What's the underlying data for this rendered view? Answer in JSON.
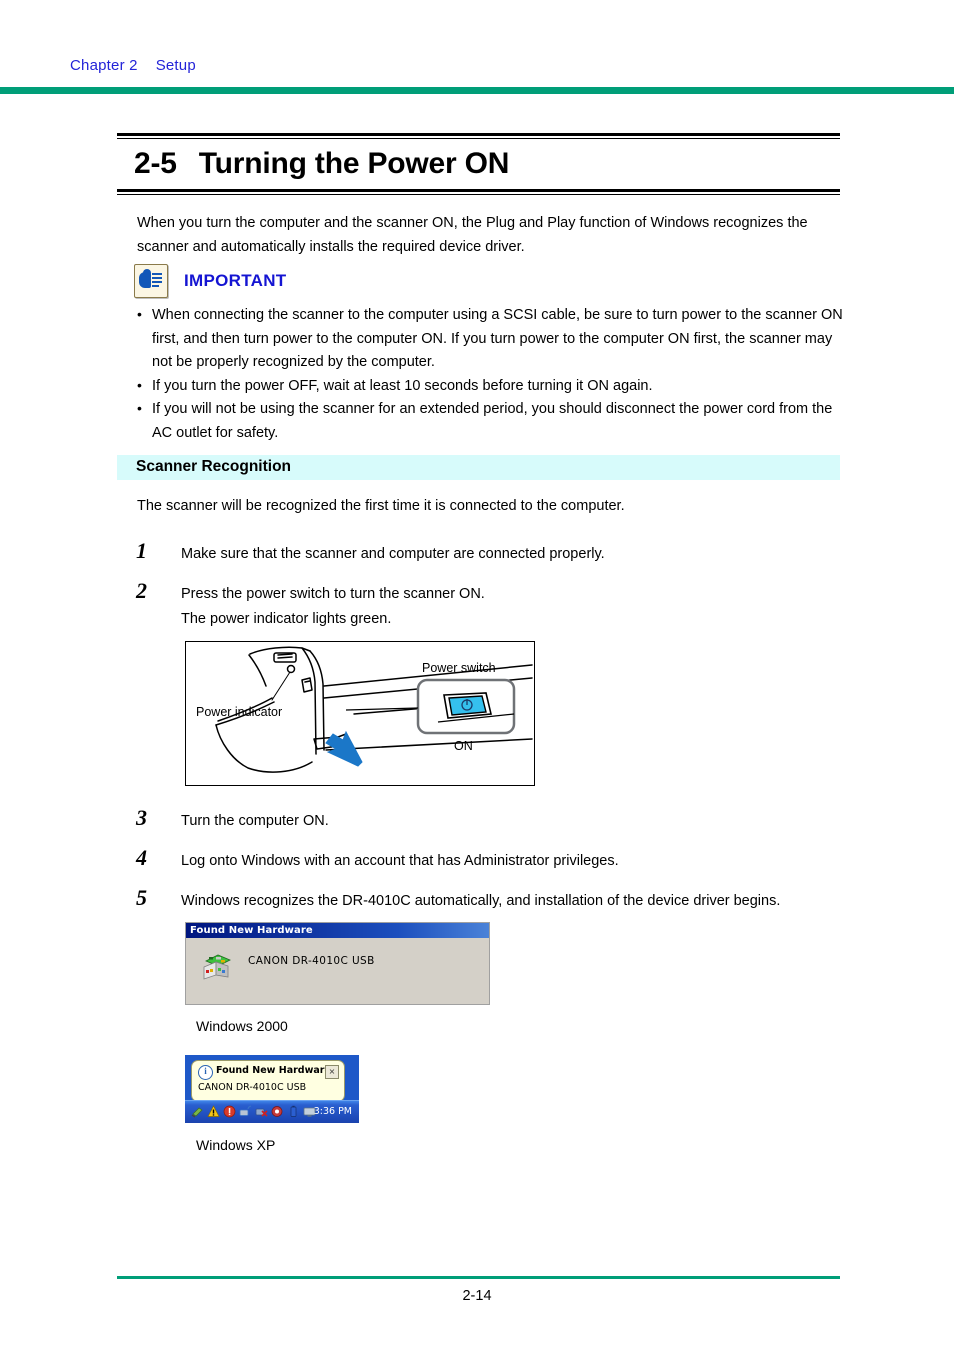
{
  "header": {
    "chapter": "Chapter 2",
    "section": "Setup",
    "rule_color": "#009e78",
    "text_color": "#2323d8"
  },
  "title": {
    "number": "2-5",
    "text": "Turning the Power ON"
  },
  "intro": "When you turn the computer and the scanner ON, the Plug and Play function of Windows recognizes the scanner and automatically installs the required device driver.",
  "important": {
    "icon": "pointing-hand-icon",
    "label": "IMPORTANT",
    "label_color": "#1414d2",
    "items": [
      "When connecting the scanner to the computer using a SCSI cable, be sure to turn power to the scanner ON first, and then turn power to the computer ON. If you turn power to the computer ON first, the scanner may not be properly recognized by the computer.",
      "If you turn the power OFF, wait at least 10 seconds before turning it ON again.",
      "If you will not be using the scanner for an extended period, you should disconnect the power cord from the AC outlet for safety."
    ]
  },
  "section_heading": {
    "text": "Scanner Recognition",
    "band_color": "#d7fbfb"
  },
  "section_intro": "The scanner will be recognized the first time it is connected to the computer.",
  "steps": [
    {
      "number": "1",
      "lines": [
        "Make sure that the scanner and computer are connected properly."
      ]
    },
    {
      "number": "2",
      "lines": [
        "Press the power switch to turn the scanner ON.",
        "The power indicator lights green."
      ]
    },
    {
      "number": "3",
      "lines": [
        "Turn the computer ON."
      ]
    },
    {
      "number": "4",
      "lines": [
        "Log onto Windows with an account that has Administrator privileges."
      ]
    },
    {
      "number": "5",
      "lines": [
        "Windows recognizes the DR-4010C automatically, and installation of the device driver begins."
      ]
    }
  ],
  "illustration": {
    "name": "scanner-power-switch-diagram",
    "labels": {
      "power_indicator": "Power indicator",
      "power_switch": "Power switch",
      "on": "ON"
    },
    "arrow_color": "#1b77c8",
    "switch_color": "#35c0ee"
  },
  "win2000_dialog": {
    "title": "Found New Hardware",
    "device": "CANON   DR-4010C USB",
    "icon": "new-hardware-icon",
    "caption": "Windows 2000",
    "titlebar_color": "#00157f",
    "face_color": "#d4d0c8"
  },
  "winxp_balloon": {
    "title": "Found New Hardware",
    "device": "CANON DR-4010C USB",
    "close_label": "×",
    "info_icon": "info-icon",
    "clock": "3:36 PM",
    "caption": "Windows XP",
    "taskbar_color": "#1e58c8",
    "balloon_color": "#ffffe1",
    "tray_icons": [
      {
        "name": "usb-icon",
        "color": "#7ab648"
      },
      {
        "name": "warning-icon",
        "color": "#f5c518"
      },
      {
        "name": "shield-alert-icon",
        "color": "#d83a2a"
      },
      {
        "name": "network-icon",
        "color": "#3a74c8"
      },
      {
        "name": "network-disconnected-icon",
        "color": "#4a6fbe"
      },
      {
        "name": "antivirus-icon",
        "color": "#c43a3a"
      },
      {
        "name": "battery-icon",
        "color": "#2b5fd0"
      },
      {
        "name": "display-icon",
        "color": "#9ab0c8"
      }
    ]
  },
  "footer": {
    "page_number": "2-14",
    "rule_color": "#009e78"
  }
}
